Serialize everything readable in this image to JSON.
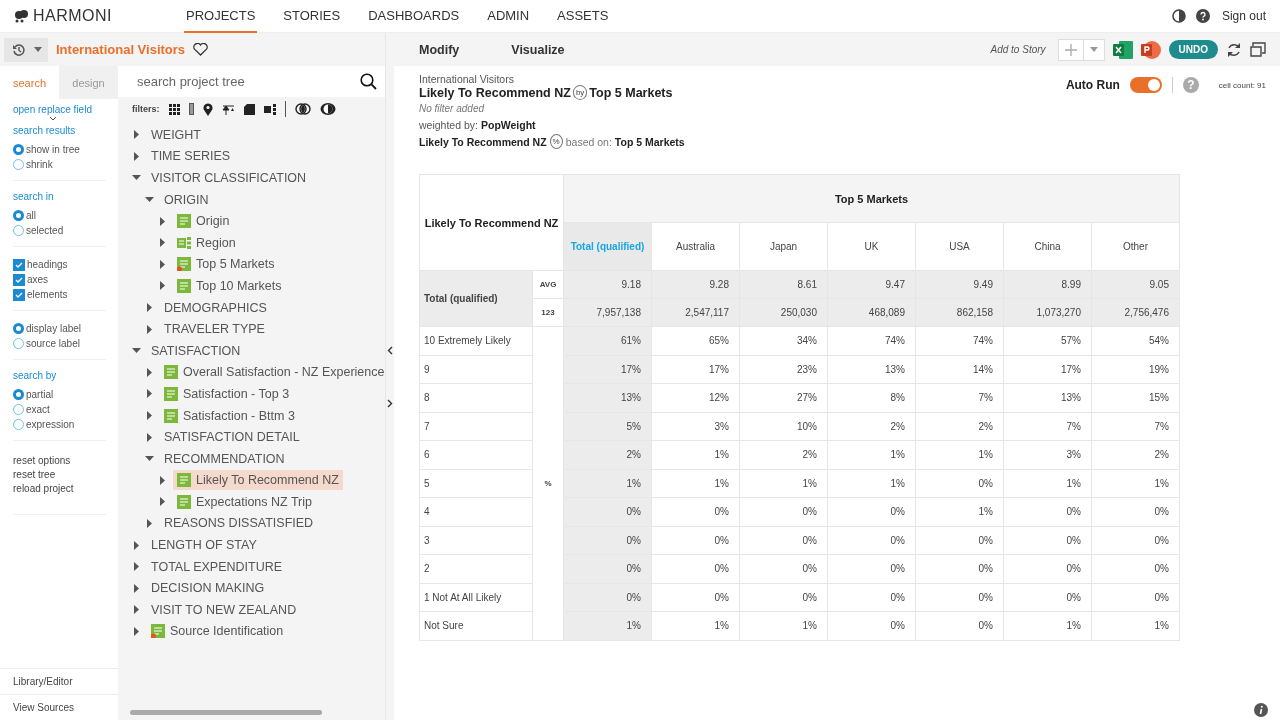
{
  "nav": {
    "brand": "HARMONI",
    "tabs": [
      {
        "label": "PROJECTS",
        "selected": true
      },
      {
        "label": "STORIES",
        "selected": false
      },
      {
        "label": "DASHBOARDS",
        "selected": false
      },
      {
        "label": "ADMIN",
        "selected": false
      },
      {
        "label": "ASSETS",
        "selected": false
      }
    ],
    "sign_out": "Sign out"
  },
  "project": {
    "title": "International Visitors",
    "favorite": false
  },
  "options": {
    "tabs": [
      {
        "label": "search",
        "selected": true
      },
      {
        "label": "design",
        "selected": false
      }
    ],
    "replace_link": "open replace field",
    "groups": [
      {
        "title": "search results",
        "kind": "radio",
        "items": [
          {
            "label": "show in tree",
            "checked": true
          },
          {
            "label": "shrink",
            "checked": false
          }
        ]
      },
      {
        "title": "search in",
        "kind": "radio",
        "items": [
          {
            "label": "all",
            "checked": true
          },
          {
            "label": "selected",
            "checked": false
          }
        ]
      },
      {
        "kind": "checkbox",
        "items": [
          {
            "label": "headings",
            "checked": true
          },
          {
            "label": "axes",
            "checked": true
          },
          {
            "label": "elements",
            "checked": true
          }
        ]
      },
      {
        "kind": "radio",
        "items": [
          {
            "label": "display label",
            "checked": true
          },
          {
            "label": "source label",
            "checked": false
          }
        ]
      },
      {
        "title": "search by",
        "kind": "radio",
        "items": [
          {
            "label": "partial",
            "checked": true
          },
          {
            "label": "exact",
            "checked": false
          },
          {
            "label": "expression",
            "checked": false
          }
        ]
      }
    ],
    "links": [
      "reset options",
      "reset tree",
      "reload project"
    ],
    "bottom_links": [
      "Library/Editor",
      "View Sources"
    ]
  },
  "tree": {
    "placeholder": "search project tree",
    "filters_label": "filters:",
    "items": [
      {
        "label": "WEIGHT",
        "kind": "folder",
        "expanded": false,
        "selected": false
      },
      {
        "label": "TIME SERIES",
        "kind": "folder",
        "expanded": false,
        "selected": false
      },
      {
        "label": "VISITOR CLASSIFICATION",
        "kind": "folder",
        "expanded": true,
        "selected": false,
        "children": [
          {
            "label": "ORIGIN",
            "kind": "folder",
            "expanded": true,
            "selected": false,
            "children": [
              {
                "label": "Origin",
                "kind": "variable",
                "flagged": false,
                "expanded": false,
                "selected": false
              },
              {
                "label": "Region",
                "kind": "hierarchy",
                "expanded": false,
                "selected": false
              },
              {
                "label": "Top 5 Markets",
                "kind": "variable",
                "flagged": true,
                "expanded": false,
                "selected": false
              },
              {
                "label": "Top 10 Markets",
                "kind": "variable",
                "flagged": false,
                "expanded": false,
                "selected": false
              }
            ]
          },
          {
            "label": "DEMOGRAPHICS",
            "kind": "folder",
            "expanded": false,
            "selected": false
          },
          {
            "label": "TRAVELER TYPE",
            "kind": "folder",
            "expanded": false,
            "selected": false
          }
        ]
      },
      {
        "label": "SATISFACTION",
        "kind": "folder",
        "expanded": true,
        "selected": false,
        "children": [
          {
            "label": "Overall Satisfaction - NZ Experience",
            "kind": "variable",
            "flagged": false,
            "expanded": false,
            "selected": false
          },
          {
            "label": "Satisfaction - Top 3",
            "kind": "variable",
            "flagged": false,
            "expanded": false,
            "selected": false
          },
          {
            "label": "Satisfaction - Bttm 3",
            "kind": "variable",
            "flagged": false,
            "expanded": false,
            "selected": false
          },
          {
            "label": "SATISFACTION DETAIL",
            "kind": "folder",
            "expanded": false,
            "selected": false
          },
          {
            "label": "RECOMMENDATION",
            "kind": "folder",
            "expanded": true,
            "selected": false,
            "children": [
              {
                "label": "Likely To Recommend NZ",
                "kind": "variable",
                "flagged": false,
                "expanded": false,
                "selected": true
              },
              {
                "label": "Expectations NZ Trip",
                "kind": "variable",
                "flagged": false,
                "expanded": false,
                "selected": false
              }
            ]
          },
          {
            "label": "REASONS DISSATISFIED",
            "kind": "folder",
            "expanded": false,
            "selected": false
          }
        ]
      },
      {
        "label": "LENGTH OF STAY",
        "kind": "folder",
        "expanded": false,
        "selected": false
      },
      {
        "label": "TOTAL EXPENDITURE",
        "kind": "folder",
        "expanded": false,
        "selected": false
      },
      {
        "label": "DECISION MAKING",
        "kind": "folder",
        "expanded": false,
        "selected": false
      },
      {
        "label": "VISIT TO NEW ZEALAND",
        "kind": "folder",
        "expanded": false,
        "selected": false
      },
      {
        "label": "Source Identification",
        "kind": "variable",
        "flagged": true,
        "expanded": false,
        "selected": false
      }
    ]
  },
  "toolbar": {
    "tabs": [
      "Modify",
      "Visualize"
    ],
    "add_to_story": "Add to Story",
    "undo": "UNDO"
  },
  "summary": {
    "project": "International Visitors",
    "row_var": "Likely To Recommend NZ",
    "by": "by",
    "col_var": "Top 5 Markets",
    "filter": "No filter added",
    "weighted_label": "weighted by:",
    "weight": "PopWeight",
    "pct_var": "Likely To Recommend NZ",
    "pct": "%",
    "based_label": "based on:",
    "base": "Top 5 Markets",
    "auto_run_label": "Auto Run",
    "auto_run": true,
    "help": "?",
    "cell_count": "cell count: 91"
  },
  "table": {
    "row_title": "Likely To Recommend NZ",
    "col_title": "Top 5 Markets",
    "columns": [
      {
        "label": "Total (qualified)",
        "selected": true
      },
      {
        "label": "Australia",
        "selected": false
      },
      {
        "label": "Japan",
        "selected": false
      },
      {
        "label": "UK",
        "selected": false
      },
      {
        "label": "USA",
        "selected": false
      },
      {
        "label": "China",
        "selected": false
      },
      {
        "label": "Other",
        "selected": false
      }
    ],
    "total_label": "Total (qualified)",
    "stats": [
      {
        "label": "AVG",
        "values": [
          "9.18",
          "9.28",
          "8.61",
          "9.47",
          "9.49",
          "8.99",
          "9.05"
        ]
      },
      {
        "label": "123",
        "values": [
          "7,957,138",
          "2,547,117",
          "250,030",
          "468,089",
          "862,158",
          "1,073,270",
          "2,756,476"
        ]
      }
    ],
    "unit": "%",
    "rows": [
      {
        "label": "10 Extremely Likely",
        "values": [
          "61%",
          "65%",
          "34%",
          "74%",
          "74%",
          "57%",
          "54%"
        ]
      },
      {
        "label": "9",
        "values": [
          "17%",
          "17%",
          "23%",
          "13%",
          "14%",
          "17%",
          "19%"
        ]
      },
      {
        "label": "8",
        "values": [
          "13%",
          "12%",
          "27%",
          "8%",
          "7%",
          "13%",
          "15%"
        ]
      },
      {
        "label": "7",
        "values": [
          "5%",
          "3%",
          "10%",
          "2%",
          "2%",
          "7%",
          "7%"
        ]
      },
      {
        "label": "6",
        "values": [
          "2%",
          "1%",
          "2%",
          "1%",
          "1%",
          "3%",
          "2%"
        ]
      },
      {
        "label": "5",
        "values": [
          "1%",
          "1%",
          "1%",
          "1%",
          "0%",
          "1%",
          "1%"
        ]
      },
      {
        "label": "4",
        "values": [
          "0%",
          "0%",
          "0%",
          "0%",
          "1%",
          "0%",
          "0%"
        ]
      },
      {
        "label": "3",
        "values": [
          "0%",
          "0%",
          "0%",
          "0%",
          "0%",
          "0%",
          "0%"
        ]
      },
      {
        "label": "2",
        "values": [
          "0%",
          "0%",
          "0%",
          "0%",
          "0%",
          "0%",
          "0%"
        ]
      },
      {
        "label": "1 Not At All Likely",
        "values": [
          "0%",
          "0%",
          "0%",
          "0%",
          "0%",
          "0%",
          "0%"
        ]
      },
      {
        "label": "Not Sure",
        "values": [
          "1%",
          "1%",
          "1%",
          "0%",
          "0%",
          "1%",
          "1%"
        ]
      }
    ]
  }
}
